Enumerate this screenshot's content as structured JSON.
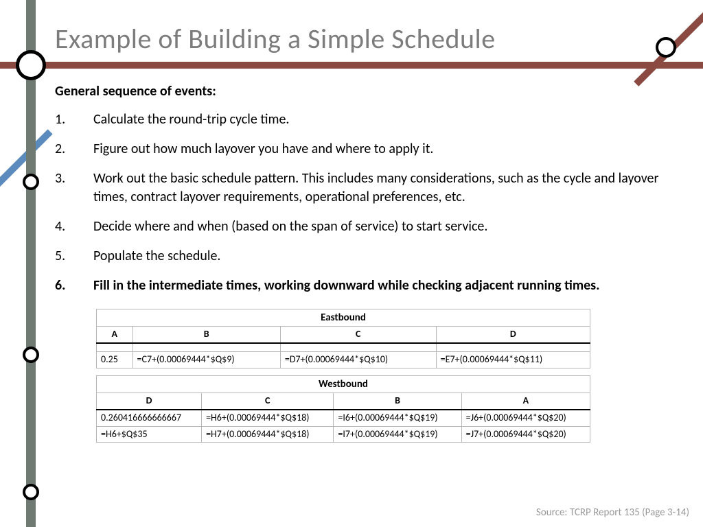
{
  "title": "Example of Building a Simple Schedule",
  "subheading": "General sequence of events:",
  "steps": [
    {
      "text": "Calculate the round-trip cycle time.",
      "bold": false
    },
    {
      "text": "Figure out how much layover you have and where to apply it.",
      "bold": false
    },
    {
      "text": "Work out the basic schedule pattern. This includes many considerations, such as the cycle and layover times, contract layover requirements, operational preferences, etc.",
      "bold": false
    },
    {
      "text": "Decide where and when (based on the span of service) to start service.",
      "bold": false
    },
    {
      "text": "Populate the schedule.",
      "bold": false
    },
    {
      "text": "Fill in the intermediate times, working downward while checking adjacent running times.",
      "bold": true
    }
  ],
  "tables": {
    "eastbound": {
      "title": "Eastbound",
      "cols": [
        "A",
        "B",
        "C",
        "D"
      ],
      "rows": [
        [
          "0.25",
          "=C7+(0.00069444*$Q$9)",
          "=D7+(0.00069444*$Q$10)",
          "=E7+(0.00069444*$Q$11)"
        ]
      ]
    },
    "westbound": {
      "title": "Westbound",
      "cols": [
        "D",
        "C",
        "B",
        "A"
      ],
      "rows": [
        [
          "0.260416666666667",
          "=H6+(0.00069444*$Q$18)",
          "=I6+(0.00069444*$Q$19)",
          "=J6+(0.00069444*$Q$20)"
        ],
        [
          "=H6+$Q$35",
          "=H7+(0.00069444*$Q$18)",
          "=I7+(0.00069444*$Q$19)",
          "=J7+(0.00069444*$Q$20)"
        ]
      ]
    }
  },
  "source": "Source: TCRP Report 135 (Page 3-14)",
  "colors": {
    "rail_red": "#8a4a41",
    "rail_gray": "#6f7a73",
    "rail_blue": "#5b8bbd",
    "title_gray": "#7c7c7c"
  }
}
